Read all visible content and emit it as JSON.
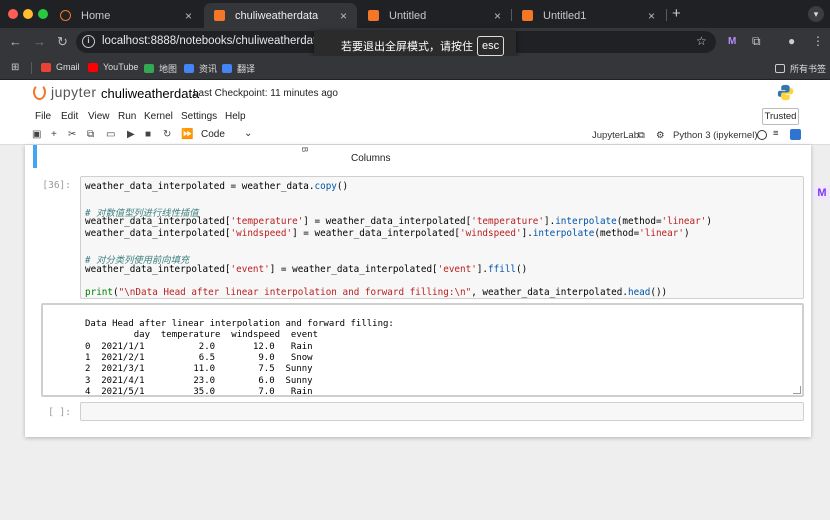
{
  "browser": {
    "tabs": [
      {
        "label": "Home",
        "active": false
      },
      {
        "label": "chuliweatherdata",
        "active": true
      },
      {
        "label": "Untitled",
        "active": false
      },
      {
        "label": "Untitled1",
        "active": false
      }
    ],
    "tab_close": "×",
    "new_tab": "+",
    "url": "localhost:8888/notebooks/chuliweatherdata.ipynb",
    "fullscreen_toast": {
      "text": "若要退出全屏模式，请按住",
      "key": "esc"
    },
    "bookmarks": [
      {
        "label": "Gmail",
        "color": "#ea4335"
      },
      {
        "label": "YouTube",
        "color": "#ff0000"
      },
      {
        "label": "地图",
        "color": "#34a853"
      },
      {
        "label": "资讯",
        "color": "#4285f4"
      },
      {
        "label": "翻译",
        "color": "#4285f4"
      }
    ],
    "all_bookmarks": "所有书签"
  },
  "jupyter": {
    "logo_text": "jupyter",
    "notebook_title": "chuliweatherdata",
    "checkpoint": "Last Checkpoint: 11 minutes ago",
    "menu": [
      "File",
      "Edit",
      "View",
      "Run",
      "Kernel",
      "Settings",
      "Help"
    ],
    "trusted": "Trusted",
    "cell_type": "Code",
    "jupyterlab_link": "JupyterLab",
    "kernel": "Python 3 (ipykernel)",
    "accent_color": "#f37726"
  },
  "cells": {
    "prev_output_label": "Columns",
    "stray_glyph": "B",
    "code_prompt": "[36]:",
    "code_lines": [
      [
        {
          "t": "weather_data_interpolated = weather_data.",
          "c": ""
        },
        {
          "t": "copy",
          "c": "fn"
        },
        {
          "t": "()",
          "c": ""
        }
      ],
      [],
      [
        {
          "t": "# 对数值型列进行线性插值",
          "c": "cm"
        }
      ],
      [
        {
          "t": "weather_data_interpolated[",
          "c": ""
        },
        {
          "t": "'temperature'",
          "c": "str"
        },
        {
          "t": "] = weather_data_interpolated[",
          "c": ""
        },
        {
          "t": "'temperature'",
          "c": "str"
        },
        {
          "t": "].",
          "c": ""
        },
        {
          "t": "interpolate",
          "c": "fn"
        },
        {
          "t": "(method=",
          "c": ""
        },
        {
          "t": "'linear'",
          "c": "str"
        },
        {
          "t": ")",
          "c": ""
        }
      ],
      [
        {
          "t": "weather_data_interpolated[",
          "c": ""
        },
        {
          "t": "'windspeed'",
          "c": "str"
        },
        {
          "t": "] = weather_data_interpolated[",
          "c": ""
        },
        {
          "t": "'windspeed'",
          "c": "str"
        },
        {
          "t": "].",
          "c": ""
        },
        {
          "t": "interpolate",
          "c": "fn"
        },
        {
          "t": "(method=",
          "c": ""
        },
        {
          "t": "'linear'",
          "c": "str"
        },
        {
          "t": ")",
          "c": ""
        }
      ],
      [],
      [
        {
          "t": "# 对分类列使用前向填充",
          "c": "cm"
        }
      ],
      [
        {
          "t": "weather_data_interpolated[",
          "c": ""
        },
        {
          "t": "'event'",
          "c": "str"
        },
        {
          "t": "] = weather_data_interpolated[",
          "c": ""
        },
        {
          "t": "'event'",
          "c": "str"
        },
        {
          "t": "].",
          "c": ""
        },
        {
          "t": "ffill",
          "c": "fn"
        },
        {
          "t": "()",
          "c": ""
        }
      ],
      [],
      [
        {
          "t": "print",
          "c": "kw"
        },
        {
          "t": "(",
          "c": ""
        },
        {
          "t": "\"\\nData Head after linear interpolation and forward filling:\\n\"",
          "c": "str"
        },
        {
          "t": ", weather_data_interpolated.",
          "c": ""
        },
        {
          "t": "head",
          "c": "fn"
        },
        {
          "t": "())",
          "c": ""
        }
      ]
    ],
    "output_lines": [
      "Data Head after linear interpolation and forward filling:",
      "         day  temperature  windspeed  event",
      "0  2021/1/1          2.0       12.0   Rain",
      "1  2021/2/1          6.5        9.0   Snow",
      "2  2021/3/1         11.0        7.5  Sunny",
      "3  2021/4/1         23.0        6.0  Sunny",
      "4  2021/5/1         35.0        7.0   Rain"
    ],
    "empty_prompt": "[ ]:"
  }
}
